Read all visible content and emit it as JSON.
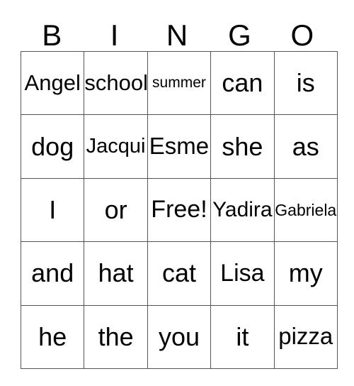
{
  "card": {
    "headers": [
      "B",
      "I",
      "N",
      "G",
      "O"
    ],
    "free_space_label": "Free!",
    "rows": [
      [
        {
          "text": "Angel",
          "size": "fs-31"
        },
        {
          "text": "school",
          "size": "fs-31"
        },
        {
          "text": "summer",
          "size": "fs-21"
        },
        {
          "text": "can",
          "size": "fs-36"
        },
        {
          "text": "is",
          "size": "fs-36"
        }
      ],
      [
        {
          "text": "dog",
          "size": "fs-36"
        },
        {
          "text": "Jacqui",
          "size": "fs-29"
        },
        {
          "text": "Esme",
          "size": "fs-33"
        },
        {
          "text": "she",
          "size": "fs-36"
        },
        {
          "text": "as",
          "size": "fs-36"
        }
      ],
      [
        {
          "text": "I",
          "size": "fs-36"
        },
        {
          "text": "or",
          "size": "fs-36"
        },
        {
          "text": "Free!",
          "size": "fs-34"
        },
        {
          "text": "Yadira",
          "size": "fs-30"
        },
        {
          "text": "Gabriela",
          "size": "fs-23"
        }
      ],
      [
        {
          "text": "and",
          "size": "fs-36"
        },
        {
          "text": "hat",
          "size": "fs-36"
        },
        {
          "text": "cat",
          "size": "fs-36"
        },
        {
          "text": "Lisa",
          "size": "fs-34"
        },
        {
          "text": "my",
          "size": "fs-36"
        }
      ],
      [
        {
          "text": "he",
          "size": "fs-36"
        },
        {
          "text": "the",
          "size": "fs-36"
        },
        {
          "text": "you",
          "size": "fs-36"
        },
        {
          "text": "it",
          "size": "fs-36"
        },
        {
          "text": "pizza",
          "size": "fs-33"
        }
      ]
    ]
  },
  "colors": {
    "background": "#ffffff",
    "border": "#555555",
    "text": "#000000"
  }
}
